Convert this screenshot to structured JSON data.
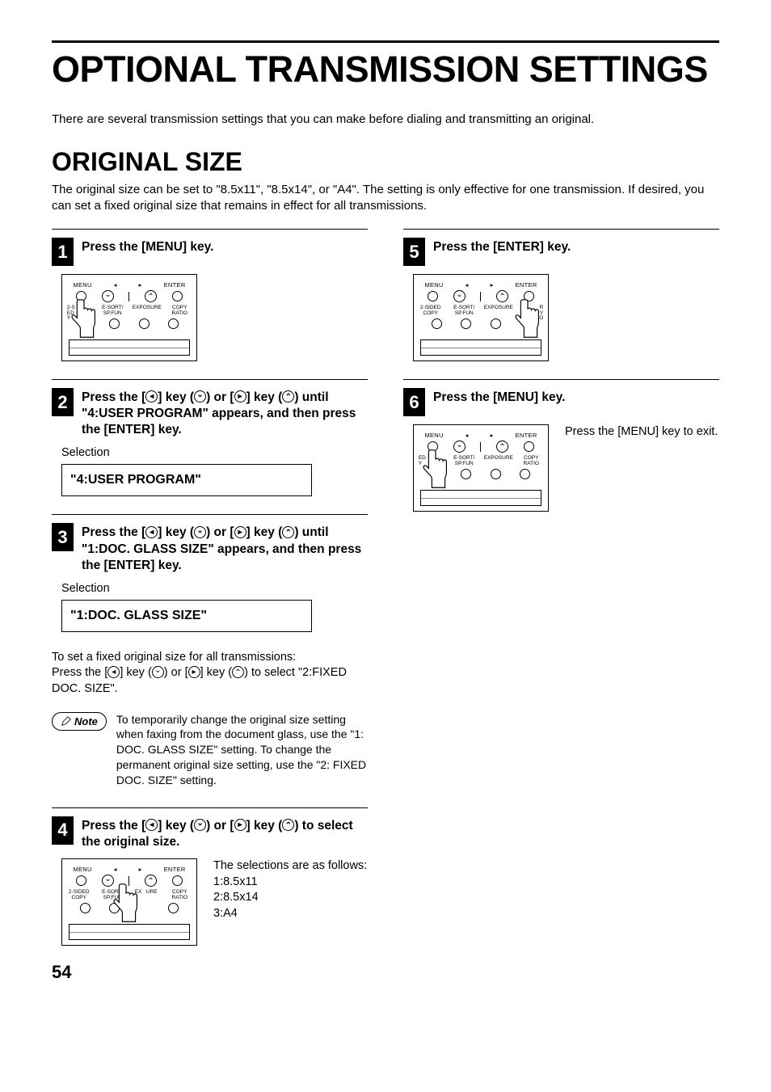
{
  "page_number": "54",
  "title": "OPTIONAL TRANSMISSION SETTINGS",
  "intro": "There are several transmission settings that you can make before dialing and transmitting an original.",
  "section": {
    "heading": "ORIGINAL SIZE",
    "description": "The original size can be set to \"8.5x11\", \"8.5x14\", or \"A4\". The setting is only effective for one transmission. If desired, you can set a fixed original size that remains in effect for all transmissions."
  },
  "panel_labels": {
    "menu": "MENU",
    "enter": "ENTER",
    "twosided": "2-SIDED COPY",
    "esort": "E-SORT/ SP.FUN",
    "exposure": "EXPOSURE",
    "copyratio": "COPY RATIO",
    "twosided_short": "2-S",
    "ed_d": "ED",
    "y_l": "Y",
    "y_r": "Y",
    "o_r": "O",
    "ex": "EX",
    "ure": "URE",
    "r": "R"
  },
  "steps": {
    "s1": {
      "num": "1",
      "title": "Press the [MENU] key."
    },
    "s2": {
      "num": "2",
      "title_a": "Press the [",
      "title_b": "] key (",
      "title_c": ") or [",
      "title_d": "] key (",
      "title_e": ") until \"4:USER PROGRAM\" appears, and then press the [ENTER] key.",
      "sel_label": "Selection",
      "lcd": "\"4:USER PROGRAM\""
    },
    "s3": {
      "num": "3",
      "title_a": "Press the [",
      "title_b": "] key (",
      "title_c": ") or [",
      "title_d": "] key (",
      "title_e": ") until \"1:DOC. GLASS SIZE\" appears, and then press the [ENTER] key.",
      "sel_label": "Selection",
      "lcd": "\"1:DOC. GLASS SIZE\"",
      "extra_a": "To set a fixed original size for all transmissions:",
      "extra_b_1": "Press the [",
      "extra_b_2": "] key (",
      "extra_b_3": ") or [",
      "extra_b_4": "] key (",
      "extra_b_5": ") to select \"2:FIXED DOC. SIZE\"."
    },
    "note": {
      "label": "Note",
      "text": "To temporarily change the original size setting when faxing from the document glass, use the \"1: DOC. GLASS SIZE\" setting. To change the permanent original size setting, use the \"2: FIXED DOC. SIZE\" setting."
    },
    "s4": {
      "num": "4",
      "title_a": "Press the [",
      "title_b": "] key (",
      "title_c": ") or [",
      "title_d": "] key (",
      "title_e": ") to select the original size.",
      "side_intro": "The selections are as follows:",
      "opt1": "1:8.5x11",
      "opt2": "2:8.5x14",
      "opt3": "3:A4"
    },
    "s5": {
      "num": "5",
      "title": "Press the [ENTER] key."
    },
    "s6": {
      "num": "6",
      "title": "Press the [MENU] key.",
      "side": "Press the [MENU] key to exit."
    }
  }
}
